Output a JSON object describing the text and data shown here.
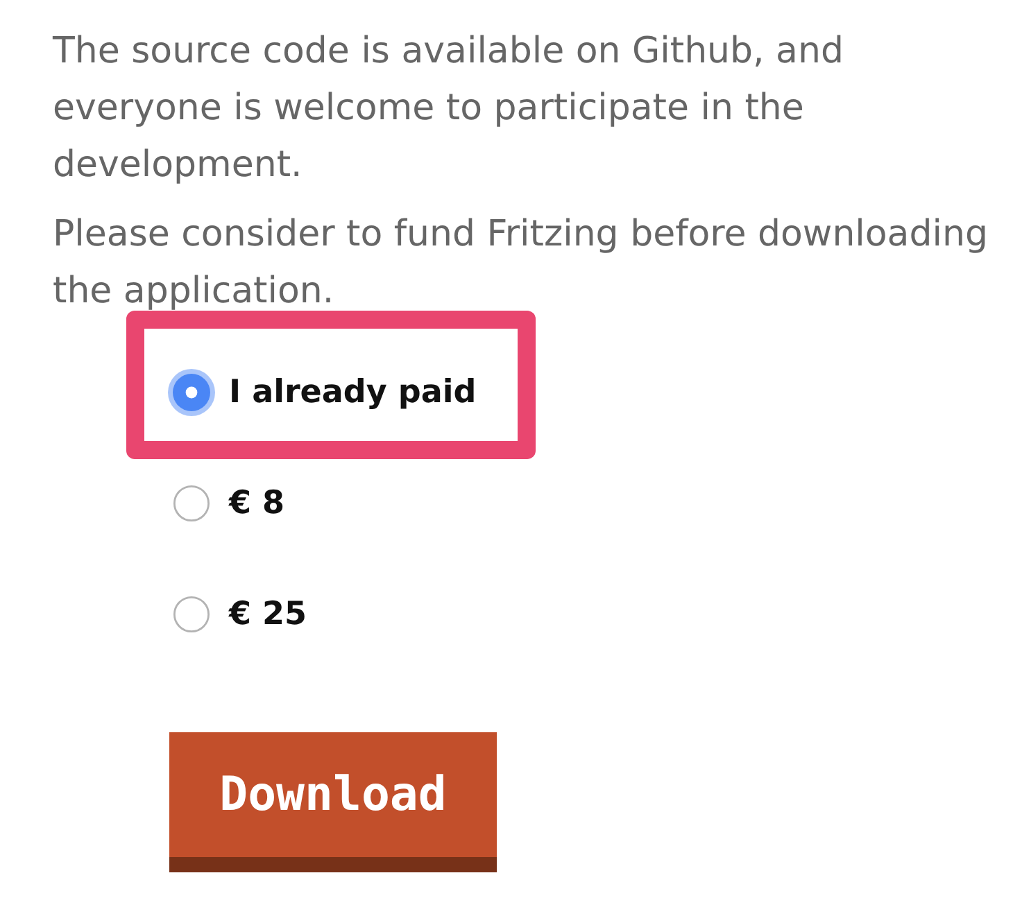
{
  "intro": {
    "paragraphs": [
      "The source code is available on Github, and everyone is welcome to participate in the development.",
      "Please consider to fund Fritzing before downloading the application."
    ]
  },
  "payment_options": [
    {
      "label": "I already paid",
      "selected": true,
      "highlighted": true
    },
    {
      "label": "€ 8",
      "selected": false,
      "highlighted": false
    },
    {
      "label": "€ 25",
      "selected": false,
      "highlighted": false
    }
  ],
  "download_button": {
    "label": "Download"
  }
}
